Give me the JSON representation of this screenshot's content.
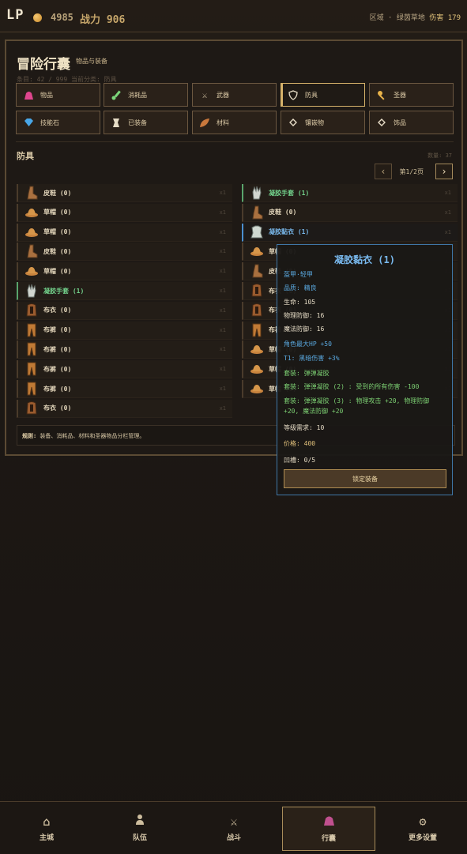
{
  "header": {
    "logo": "LP",
    "gold": "4985",
    "power": "战力 906",
    "region_prefix": "区域 · 绿茵草地",
    "damage_label": "伤害",
    "damage_value": "179"
  },
  "panel": {
    "title": "冒险行囊",
    "subtitle": "物品与装备",
    "meta": "条目: 42 / 999   当前分类: 防具"
  },
  "categories": [
    {
      "label": "物品",
      "icon": "bag-icon"
    },
    {
      "label": "消耗品",
      "icon": "potion-icon"
    },
    {
      "label": "武器",
      "icon": "swords-icon"
    },
    {
      "label": "防具",
      "icon": "shield-icon"
    },
    {
      "label": "圣器",
      "icon": "key-icon"
    },
    {
      "label": "技能石",
      "icon": "gem-icon"
    },
    {
      "label": "已装备",
      "icon": "armor-icon"
    },
    {
      "label": "材料",
      "icon": "leaf-icon"
    },
    {
      "label": "镶嵌物",
      "icon": "diamond-icon"
    },
    {
      "label": "饰品",
      "icon": "diamond-icon"
    }
  ],
  "section": {
    "title": "防具",
    "count": "数量: 37",
    "page": "第1/2页",
    "prev": "‹",
    "next": "›"
  },
  "left_items": [
    {
      "name": "皮鞋 (0)",
      "qty": "x1",
      "icon": "boot-icon"
    },
    {
      "name": "草帽 (0)",
      "qty": "x1",
      "icon": "hat-icon"
    },
    {
      "name": "草帽 (0)",
      "qty": "x1",
      "icon": "hat-icon"
    },
    {
      "name": "皮鞋 (0)",
      "qty": "x1",
      "icon": "boot-icon"
    },
    {
      "name": "草帽 (0)",
      "qty": "x1",
      "icon": "hat-icon"
    },
    {
      "name": "凝胶手套 (1)",
      "qty": "x1",
      "icon": "glove-icon"
    },
    {
      "name": "布衣 (0)",
      "qty": "x1",
      "icon": "cloth-icon"
    },
    {
      "name": "布裤 (0)",
      "qty": "x1",
      "icon": "pants-icon"
    },
    {
      "name": "布裤 (0)",
      "qty": "x1",
      "icon": "pants-icon"
    },
    {
      "name": "布裤 (0)",
      "qty": "x1",
      "icon": "pants-icon"
    },
    {
      "name": "布裤 (0)",
      "qty": "x1",
      "icon": "pants-icon"
    },
    {
      "name": "布衣 (0)",
      "qty": "x1",
      "icon": "cloth-icon"
    }
  ],
  "right_items": [
    {
      "name": "凝胶手套 (1)",
      "qty": "x1",
      "icon": "glove-icon"
    },
    {
      "name": "皮鞋 (0)",
      "qty": "x1",
      "icon": "boot-icon"
    },
    {
      "name": "凝胶黏衣 (1)",
      "qty": "x1",
      "icon": "armor-icon"
    },
    {
      "name": "草帽 (0)",
      "qty": "x1",
      "icon": "hat-icon"
    },
    {
      "name": "皮鞋 (0)",
      "qty": "x1",
      "icon": "boot-icon"
    },
    {
      "name": "布衣 (0)",
      "qty": "x1",
      "icon": "cloth-icon"
    },
    {
      "name": "布衣 (0)",
      "qty": "x1",
      "icon": "cloth-icon"
    },
    {
      "name": "布裤 (0)",
      "qty": "x1",
      "icon": "pants-icon"
    },
    {
      "name": "草帽 (0)",
      "qty": "x1",
      "icon": "hat-icon"
    },
    {
      "name": "草帽 (0)",
      "qty": "x1",
      "icon": "hat-icon"
    },
    {
      "name": "草帽 (0)",
      "qty": "x1",
      "icon": "hat-icon"
    }
  ],
  "tip": {
    "bold": "规则:",
    "text": " 装备、消耗品、材料和圣器物品分栏管理。"
  },
  "popup": {
    "title": "凝胶黏衣 (1)",
    "type": "盔甲·轻甲",
    "quality": "品质: 精良",
    "hp": "生命: 105",
    "pdef": "物理防御: 16",
    "mdef": "魔法防御: 16",
    "bonus_hp": "角色最大HP +50",
    "t1": "T1: 黑暗伤害 +3%",
    "set_name": "套装: 弹弹凝胶",
    "set2": "套装: 弹弹凝胶 (2) : 受到的所有伤害 -100",
    "set3": "套装: 弹弹凝胶 (3) : 物理攻击 +20, 物理防御 +20, 魔法防御 +20",
    "level": "等级需求: 10",
    "price": "价格: 400",
    "sockets": "凹槽: 0/5",
    "lock_button": "锁定装备"
  },
  "nav": [
    {
      "label": "主城",
      "icon": "home-icon"
    },
    {
      "label": "队伍",
      "icon": "person-icon"
    },
    {
      "label": "战斗",
      "icon": "swords-icon"
    },
    {
      "label": "行囊",
      "icon": "bag-icon"
    },
    {
      "label": "更多设置",
      "icon": "gear-icon"
    }
  ]
}
